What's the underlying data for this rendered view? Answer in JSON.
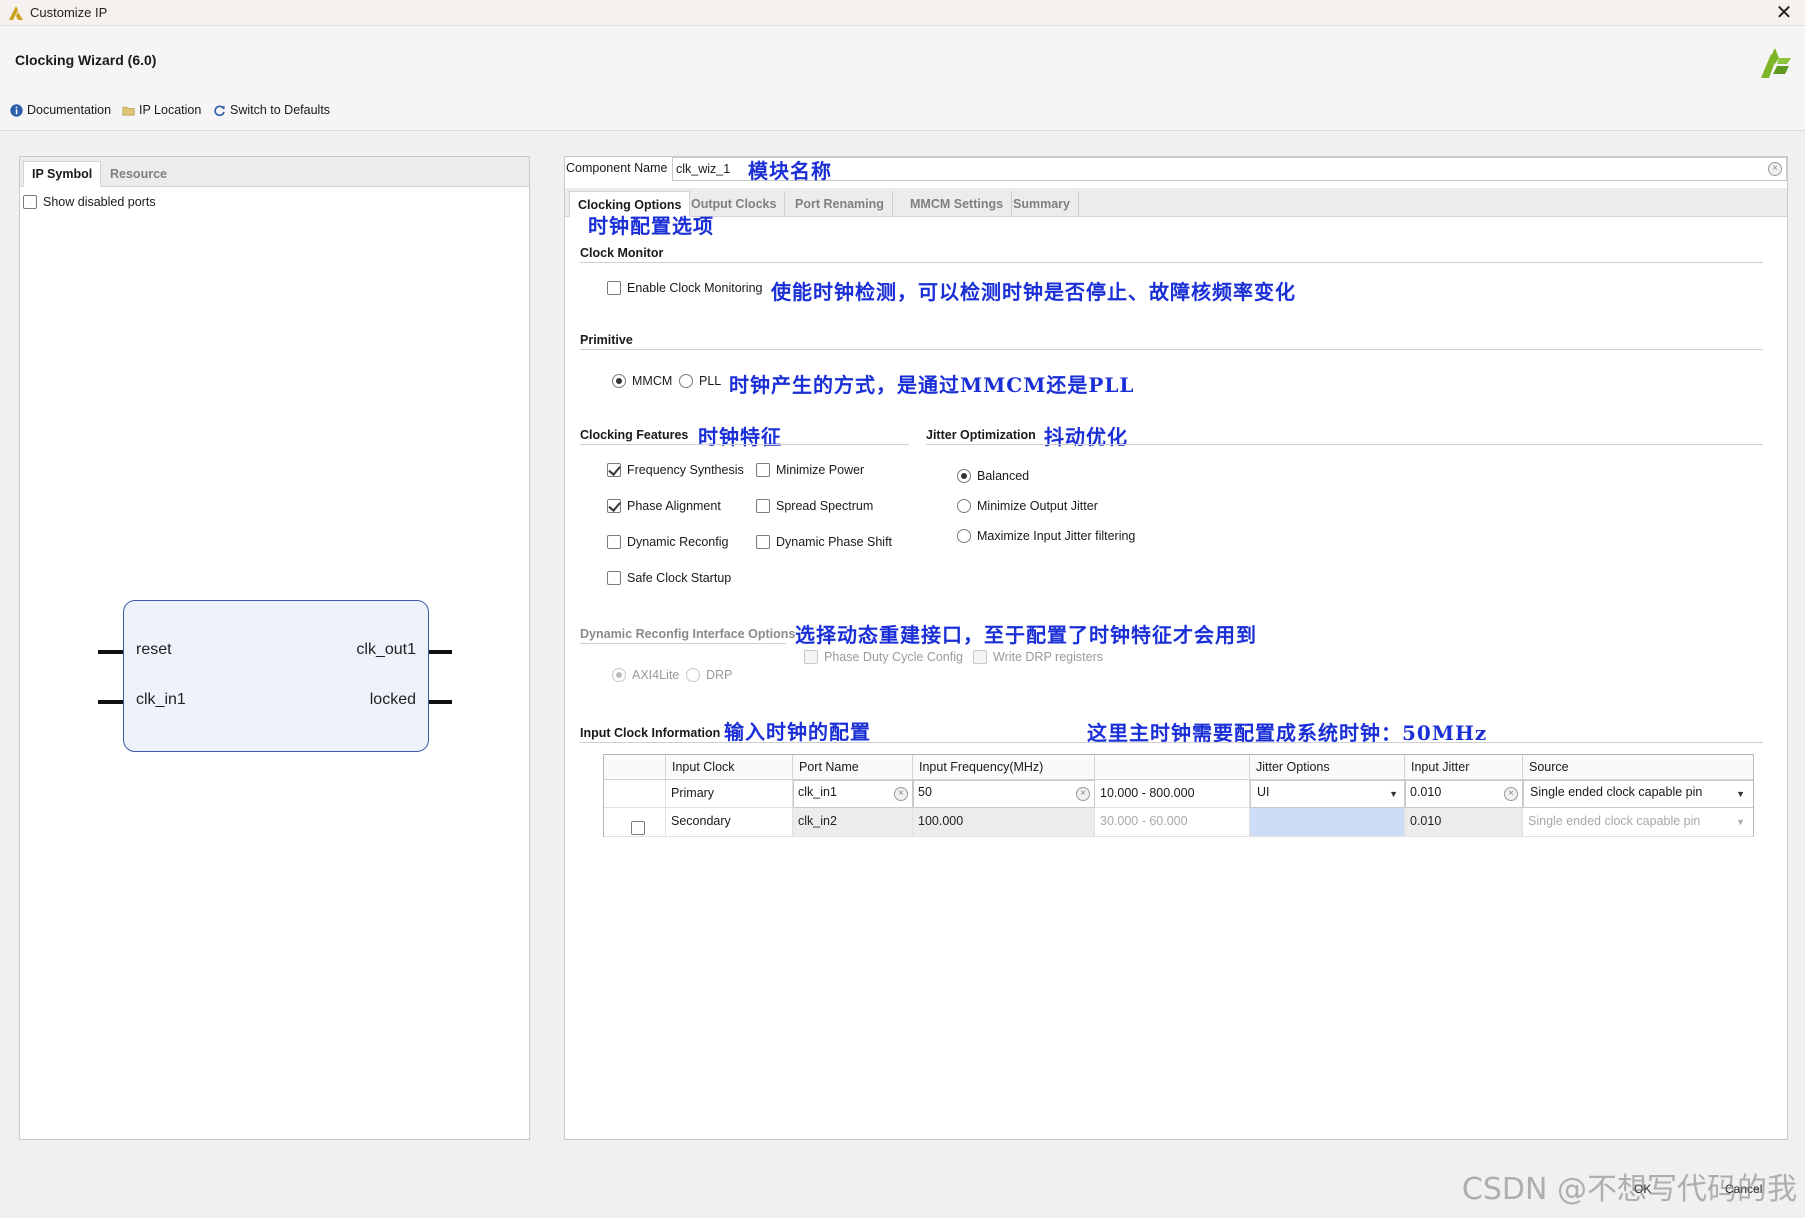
{
  "window": {
    "title": "Customize IP",
    "close_glyph": "✕"
  },
  "header": {
    "wizard_title": "Clocking Wizard (6.0)",
    "toolbar": {
      "documentation": "Documentation",
      "ip_location": "IP Location",
      "switch_defaults": "Switch to Defaults"
    }
  },
  "left": {
    "tabs": [
      "IP Symbol",
      "Resource"
    ],
    "show_disabled": "Show disabled ports",
    "symbol": {
      "pins_left": [
        "reset",
        "clk_in1"
      ],
      "pins_right": [
        "clk_out1",
        "locked"
      ]
    }
  },
  "right": {
    "component_name_label": "Component Name",
    "component_name_value": "clk_wiz_1",
    "tabs": [
      "Clocking Options",
      "Output Clocks",
      "Port Renaming",
      "MMCM Settings",
      "Summary"
    ],
    "clock_monitor": {
      "title": "Clock Monitor",
      "enable": "Enable Clock Monitoring"
    },
    "primitive": {
      "title": "Primitive",
      "options": [
        "MMCM",
        "PLL"
      ]
    },
    "clocking_features": {
      "title": "Clocking Features",
      "items": [
        "Frequency Synthesis",
        "Minimize Power",
        "Phase Alignment",
        "Spread Spectrum",
        "Dynamic Reconfig",
        "Dynamic Phase Shift",
        "Safe Clock Startup"
      ]
    },
    "jitter_optimization": {
      "title": "Jitter Optimization",
      "options": [
        "Balanced",
        "Minimize Output Jitter",
        "Maximize Input Jitter filtering"
      ]
    },
    "dynamic_reconfig": {
      "title": "Dynamic Reconfig Interface Options",
      "options": [
        "AXI4Lite",
        "DRP"
      ],
      "checks": [
        "Phase Duty Cycle Config",
        "Write DRP registers"
      ]
    },
    "input_clock": {
      "title": "Input Clock Information",
      "headers": [
        "Input Clock",
        "Port Name",
        "Input Frequency(MHz)",
        "",
        "Jitter Options",
        "Input Jitter",
        "Source"
      ],
      "rows": [
        {
          "clock": "Primary",
          "port": "clk_in1",
          "freq": "50",
          "range": "10.000 - 800.000",
          "jitter_opt": "UI",
          "jitter": "0.010",
          "source": "Single ended clock capable pin"
        },
        {
          "clock": "Secondary",
          "port": "clk_in2",
          "freq": "100.000",
          "range": "30.000 - 60.000",
          "jitter_opt": "",
          "jitter": "0.010",
          "source": "Single ended clock capable pin"
        }
      ]
    },
    "annotations": {
      "component_name": "模块名称",
      "clocking_options": "时钟配置选项",
      "clock_monitor": "使能时钟检测，可以检测时钟是否停止、故障核频率变化",
      "primitive": "时钟产生的方式，是通过MMCM还是PLL",
      "clocking_features": "时钟特征",
      "jitter": "抖动优化",
      "dynamic_reconfig": "选择动态重建接口，至于配置了时钟特征才会用到",
      "input_clock": "输入时钟的配置",
      "primary_clock": "这里主时钟需要配置成系统时钟：50MHz"
    }
  },
  "footer": {
    "ok": "OK",
    "cancel": "Cancel",
    "watermark": "CSDN @不想写代码的我"
  },
  "colors": {
    "annotation": "#1a2fd6",
    "symbol_border": "#3a5ea8",
    "symbol_fill": "#eef3fb",
    "selected_cell": "#cfdcf6"
  }
}
